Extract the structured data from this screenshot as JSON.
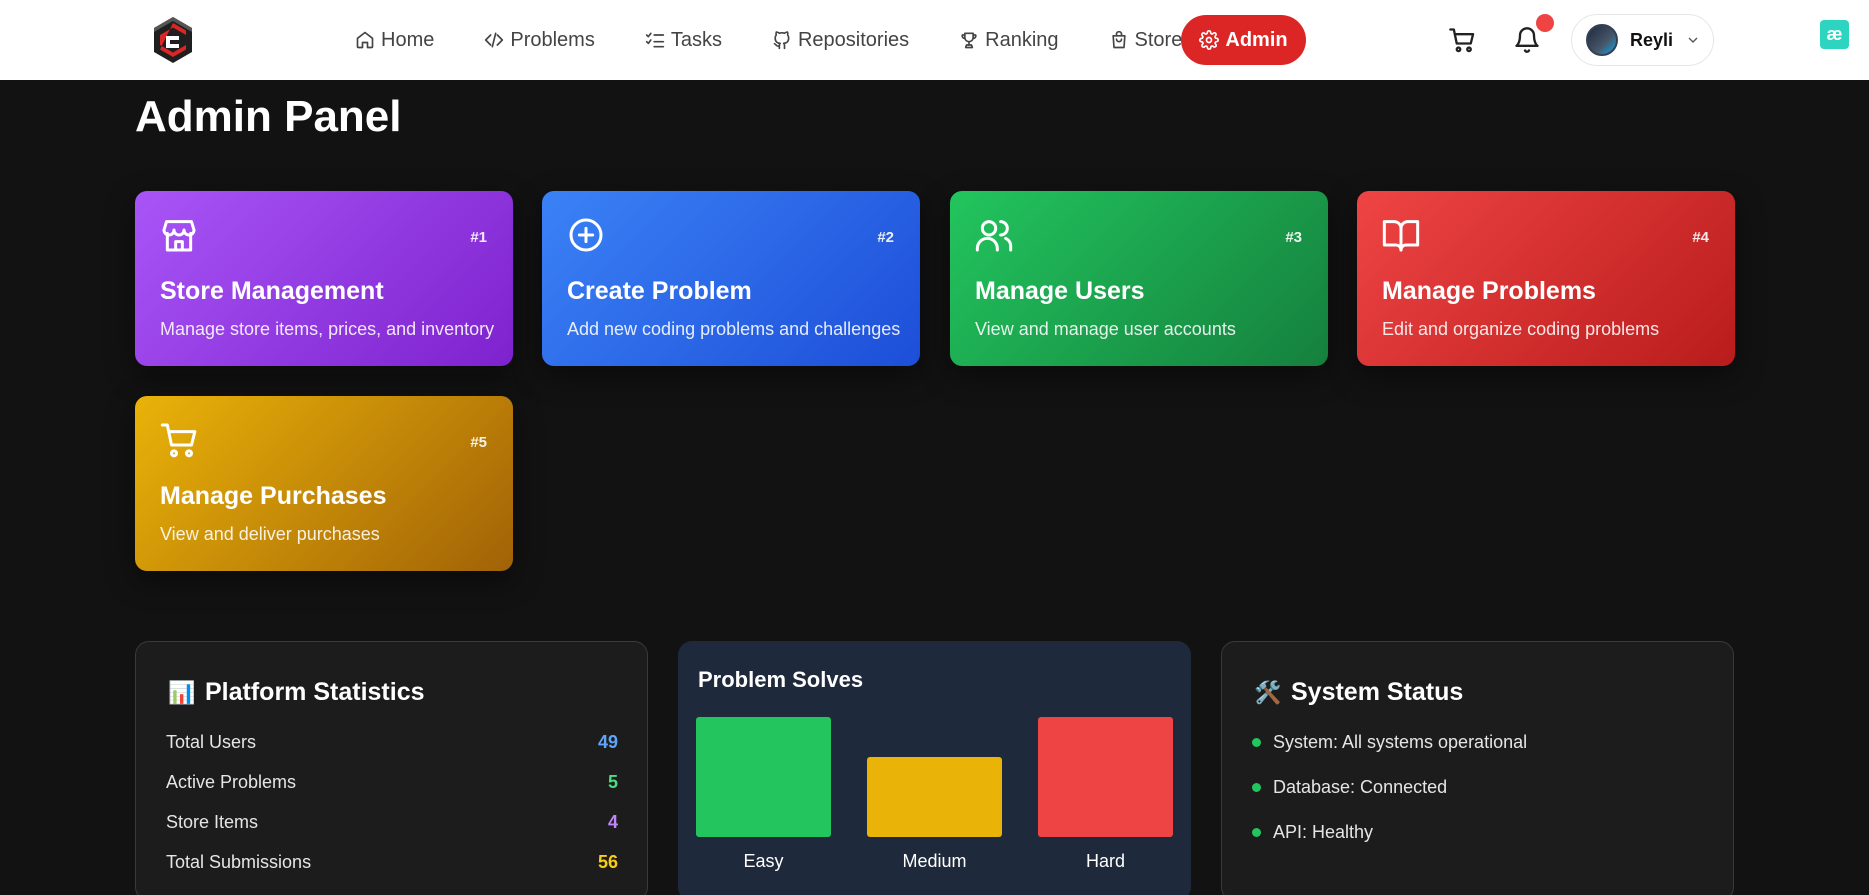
{
  "nav": {
    "links": [
      {
        "label": "Home",
        "icon": "home-icon"
      },
      {
        "label": "Problems",
        "icon": "code-icon"
      },
      {
        "label": "Tasks",
        "icon": "list-checks-icon"
      },
      {
        "label": "Repositories",
        "icon": "github-icon"
      },
      {
        "label": "Ranking",
        "icon": "trophy-icon"
      },
      {
        "label": "Store",
        "icon": "shopping-bag-icon"
      }
    ],
    "admin_label": "Admin",
    "user_name": "Reyli",
    "corner_badge": "æ"
  },
  "page_title": "Admin Panel",
  "cards": [
    {
      "num": "#1",
      "title": "Store Management",
      "desc": "Manage store items, prices, and inventory",
      "icon": "store-icon"
    },
    {
      "num": "#2",
      "title": "Create Problem",
      "desc": "Add new coding problems and challenges",
      "icon": "plus-circle-icon"
    },
    {
      "num": "#3",
      "title": "Manage Users",
      "desc": "View and manage user accounts",
      "icon": "users-icon"
    },
    {
      "num": "#4",
      "title": "Manage Problems",
      "desc": "Edit and organize coding problems",
      "icon": "book-open-icon"
    },
    {
      "num": "#5",
      "title": "Manage Purchases",
      "desc": "View and deliver purchases",
      "icon": "cart-icon"
    }
  ],
  "stats": {
    "title": "Platform Statistics",
    "emoji": "📊",
    "rows": [
      {
        "label": "Total Users",
        "value": "49",
        "color": "#60a5fa"
      },
      {
        "label": "Active Problems",
        "value": "5",
        "color": "#4ade80"
      },
      {
        "label": "Store Items",
        "value": "4",
        "color": "#c084fc"
      },
      {
        "label": "Total Submissions",
        "value": "56",
        "color": "#facc15"
      }
    ]
  },
  "solves_chart": {
    "title": "Problem Solves"
  },
  "chart_data": {
    "type": "bar",
    "title": "Problem Solves",
    "categories": [
      "Easy",
      "Medium",
      "Hard"
    ],
    "values": [
      3,
      2,
      3
    ],
    "colors": [
      "#22c55e",
      "#eab308",
      "#ef4444"
    ],
    "xlabel": "",
    "ylabel": "",
    "ylim": [
      0,
      3
    ],
    "grid": false
  },
  "system_status": {
    "title": "System Status",
    "emoji": "🛠️",
    "items": [
      "System: All systems operational",
      "Database: Connected",
      "API: Healthy"
    ]
  }
}
